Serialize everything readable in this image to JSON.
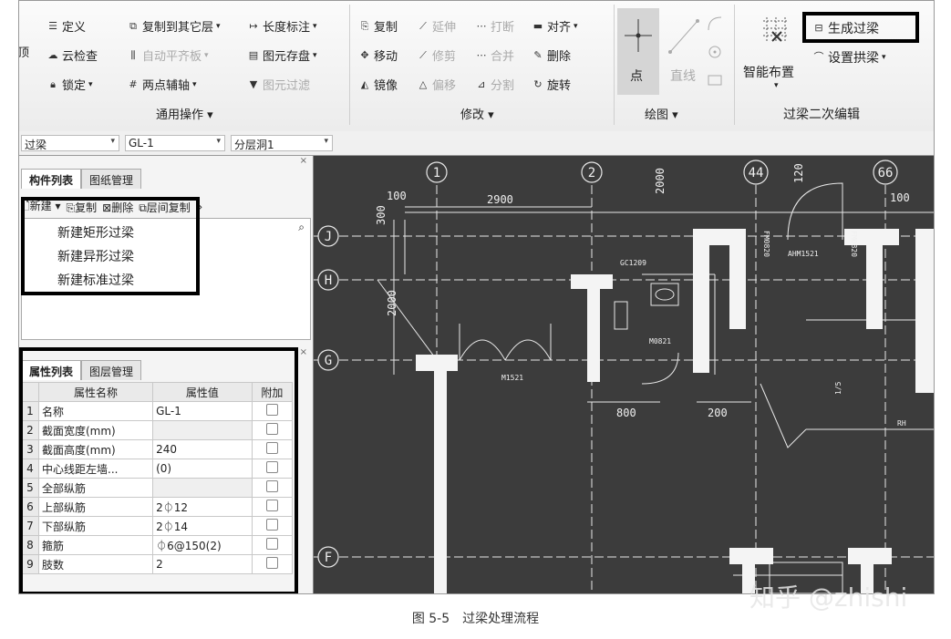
{
  "ribbon": {
    "left_cut": "顶",
    "col1": [
      "定义",
      "云检查",
      "锁定"
    ],
    "col2": [
      "复制到其它层",
      "自动平齐板",
      "两点辅轴"
    ],
    "col3": [
      "长度标注",
      "图元存盘",
      "图元过滤"
    ],
    "group_general": "通用操作",
    "modify": [
      [
        "复制",
        "延伸",
        "打断",
        "对齐"
      ],
      [
        "移动",
        "修剪",
        "合并",
        "删除"
      ],
      [
        "镜像",
        "偏移",
        "分割",
        "旋转"
      ]
    ],
    "group_modify": "修改",
    "draw_point": "点",
    "draw_line": "直线",
    "group_draw": "绘图",
    "smart_layout": "智能布置",
    "generate_beam": "生成过梁",
    "set_arch": "设置拱梁",
    "group_beam": "过梁二次编辑"
  },
  "selectors": [
    "过梁",
    "GL-1",
    "分层洞1"
  ],
  "component_panel": {
    "tabs": [
      "构件列表",
      "图纸管理"
    ],
    "toolbar": [
      "新建",
      "复制",
      "删除",
      "层间复制"
    ],
    "new_menu": [
      "新建矩形过梁",
      "新建异形过梁",
      "新建标准过梁"
    ]
  },
  "property_panel": {
    "tabs": [
      "属性列表",
      "图层管理"
    ],
    "headers": [
      "属性名称",
      "属性值",
      "附加"
    ],
    "rows": [
      {
        "num": "1",
        "name": "名称",
        "value": "GL-1"
      },
      {
        "num": "2",
        "name": "截面宽度(mm)",
        "value": ""
      },
      {
        "num": "3",
        "name": "截面高度(mm)",
        "value": "240"
      },
      {
        "num": "4",
        "name": "中心线距左墙...",
        "value": "(0)"
      },
      {
        "num": "5",
        "name": "全部纵筋",
        "value": ""
      },
      {
        "num": "6",
        "name": "上部纵筋",
        "value": "2⏀12"
      },
      {
        "num": "7",
        "name": "下部纵筋",
        "value": "2⏀14"
      },
      {
        "num": "8",
        "name": "箍筋",
        "value": "⏀6@150(2)"
      },
      {
        "num": "9",
        "name": "肢数",
        "value": "2"
      }
    ]
  },
  "cad": {
    "axis_labels": [
      "1",
      "2",
      "44",
      "66",
      "J",
      "H",
      "G",
      "F"
    ],
    "dims": [
      "100",
      "2900",
      "300",
      "2000",
      "2000",
      "120",
      "100",
      "800",
      "200"
    ],
    "tags": [
      "GC1209",
      "AHM1521",
      "FM0820",
      "FM0820",
      "M0821",
      "M1521",
      "1/5",
      "RH"
    ]
  },
  "caption": "图 5-5　过梁处理流程",
  "watermark": "知乎 @zhishi",
  "colors": {
    "highlight": "#000000",
    "canvas": "#3c3c3c",
    "lines": "#ffffff"
  }
}
